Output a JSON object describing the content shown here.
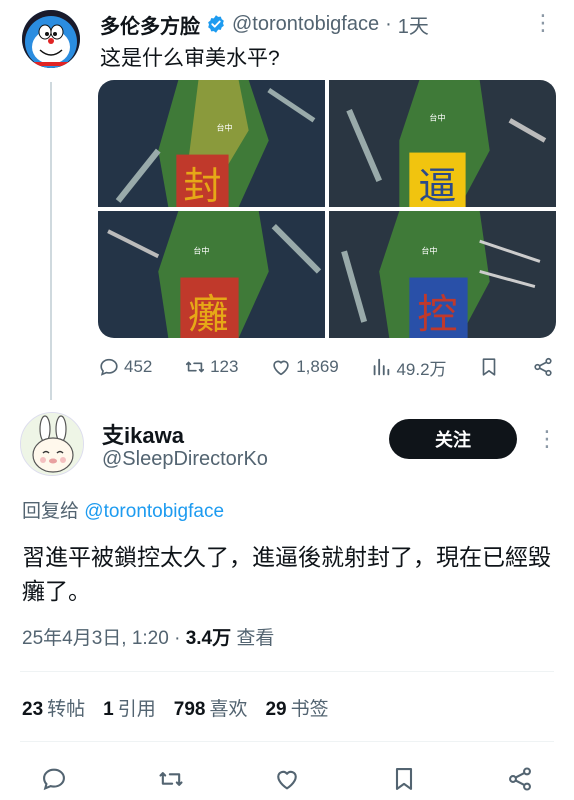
{
  "tweet1": {
    "display_name": "多伦多方脸",
    "handle": "@torontobigface",
    "separator": "·",
    "time": "1天",
    "text": "这是什么审美水平?",
    "image_labels": {
      "label1": "台中",
      "label2": "台中",
      "label3": "台中",
      "label4": "台中"
    },
    "replies": "452",
    "retweets": "123",
    "likes": "1,869",
    "views": "49.2万"
  },
  "tweet2": {
    "display_name": "支ikawa",
    "handle": "@SleepDirectorKo",
    "follow_label": "关注",
    "reply_prefix": "回复给",
    "reply_target": "@torontobigface",
    "text": "習進平被鎖控太久了，進逼後就射封了，現在已經毀癱了。",
    "timestamp": "25年4月3日, 1:20",
    "dot": "·",
    "views_count": "3.4万",
    "views_label": "查看",
    "stats": {
      "reposts_count": "23",
      "reposts_label": "转帖",
      "quotes_count": "1",
      "quotes_label": "引用",
      "likes_count": "798",
      "likes_label": "喜欢",
      "bookmarks_count": "29",
      "bookmarks_label": "书签"
    }
  },
  "colors": {
    "text_primary": "#0f1419",
    "text_secondary": "#536471",
    "link": "#1d9bf0",
    "verified": "#1d9bf0",
    "follow_bg": "#0f1419",
    "divider": "#eff3f4"
  },
  "icons": [
    "verified-badge-icon",
    "more-icon",
    "reply-icon",
    "retweet-icon",
    "like-icon",
    "views-icon",
    "bookmark-icon",
    "share-icon"
  ]
}
